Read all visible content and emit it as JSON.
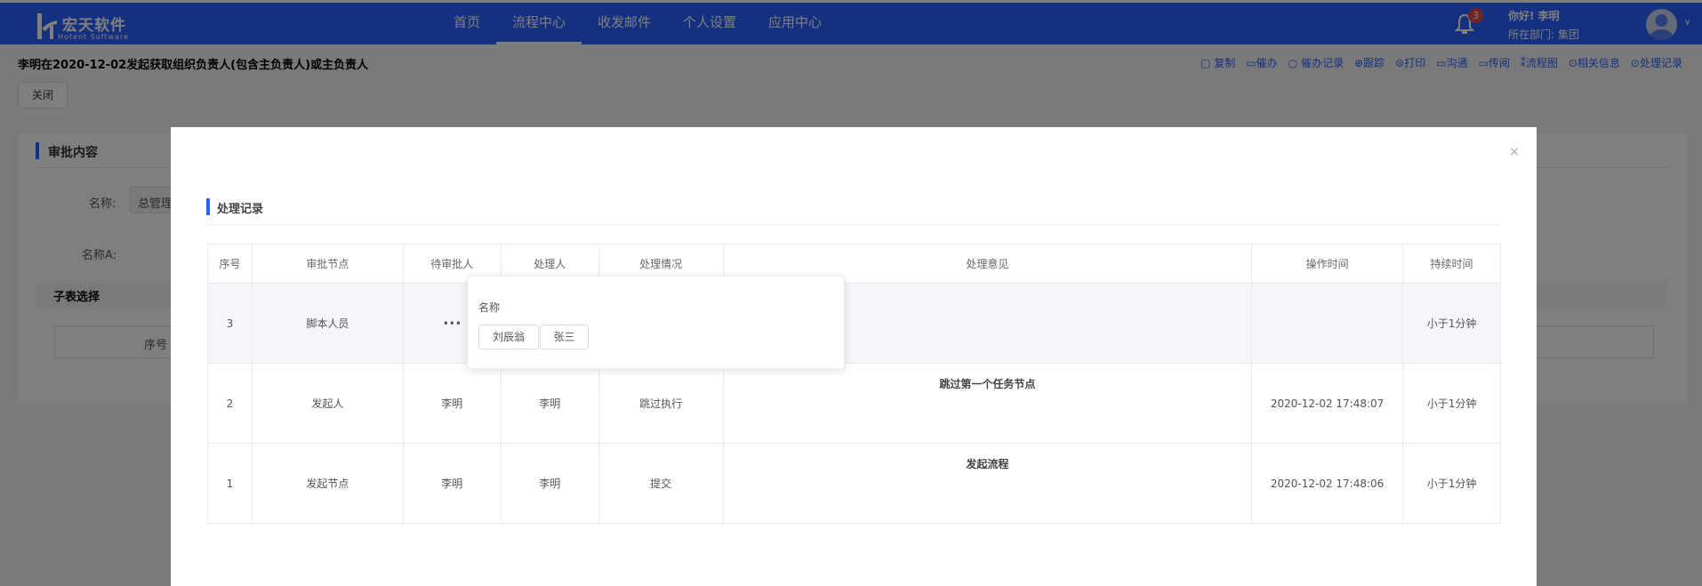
{
  "brand": {
    "name": "宏天软件",
    "sub": "Hotent Software"
  },
  "nav": [
    {
      "label": "首页"
    },
    {
      "label": "流程中心"
    },
    {
      "label": "收发邮件"
    },
    {
      "label": "个人设置"
    },
    {
      "label": "应用中心"
    }
  ],
  "user": {
    "badge": "3",
    "greeting": "你好! 李明",
    "dept": "所在部门: 集团"
  },
  "doc_title": "李明在2020-12-02发起获取组织负责人(包含主负责人)或主负责人",
  "close_label": "关闭",
  "toolbar": [
    "复制",
    "催办",
    "催办记录",
    "跟踪",
    "打印",
    "沟通",
    "传阅",
    "流程图",
    "相关信息",
    "处理记录"
  ],
  "panel": {
    "title": "审批内容",
    "field1_label": "名称:",
    "field1_value": "总管理",
    "field2_label": "名称A:",
    "subtable": "子表选择",
    "sub_col": "序号"
  },
  "modal": {
    "close": "×",
    "title": "处理记录",
    "columns": [
      "序号",
      "审批节点",
      "待审批人",
      "处理人",
      "处理情况",
      "处理意见",
      "操作时间",
      "持续时间"
    ],
    "rows": [
      [
        "3",
        "脚本人员",
        "•••",
        "",
        "",
        "",
        "",
        "小于1分钟"
      ],
      [
        "2",
        "发起人",
        "李明",
        "李明",
        "跳过执行",
        "跳过第一个任务节点",
        "2020-12-02 17:48:07",
        "小于1分钟"
      ],
      [
        "1",
        "发起节点",
        "李明",
        "李明",
        "提交",
        "发起流程",
        "2020-12-02 17:48:06",
        "小于1分钟"
      ]
    ],
    "popover": {
      "title": "名称",
      "names": [
        "刘辰翁",
        "张三"
      ]
    }
  }
}
